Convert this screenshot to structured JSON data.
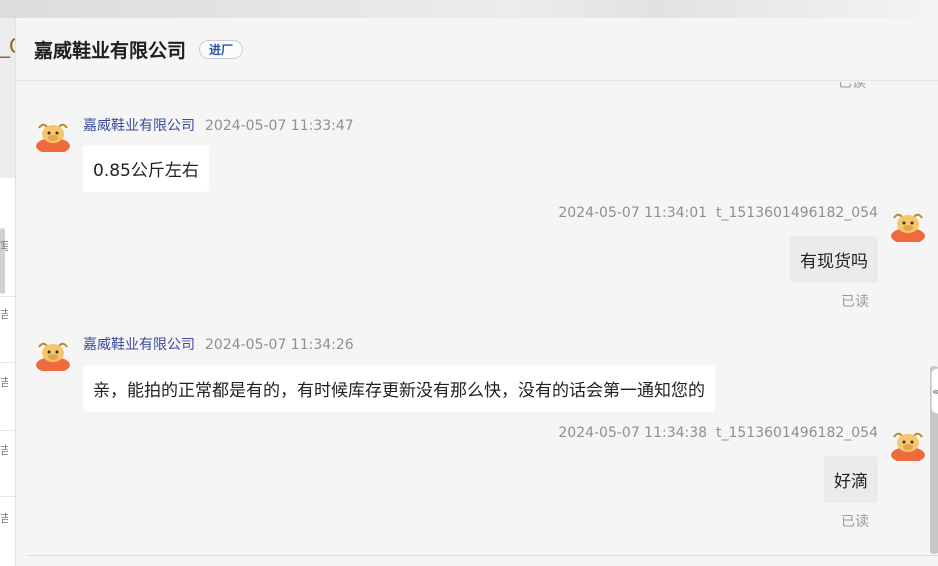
{
  "background": {
    "left_fragment": "_C",
    "left_items": [
      "写",
      "吉",
      "吉",
      "吉",
      "吉"
    ]
  },
  "header": {
    "title": "嘉威鞋业有限公司",
    "badge": "进厂"
  },
  "messages": [
    {
      "direction": "out",
      "read_status": "已读"
    },
    {
      "direction": "in",
      "sender": "嘉威鞋业有限公司",
      "time": "2024-05-07 11:33:47",
      "text": "0.85公斤左右"
    },
    {
      "direction": "out",
      "time": "2024-05-07 11:34:01",
      "sender": "t_1513601496182_054",
      "text": "有现货吗",
      "read_status": "已读"
    },
    {
      "direction": "in",
      "sender": "嘉威鞋业有限公司",
      "time": "2024-05-07 11:34:26",
      "text": "亲，能拍的正常都是有的，有时候库存更新没有那么快，没有的话会第一通知您的"
    },
    {
      "direction": "out",
      "time": "2024-05-07 11:34:38",
      "sender": "t_1513601496182_054",
      "text": "好滴",
      "read_status": "已读"
    }
  ],
  "sidebar_toggle_icon": "double-chevron-left-icon",
  "colors": {
    "sender": "#3b4a9e",
    "badge_text": "#2a56a6",
    "avatar_body": "#ef6a3c",
    "avatar_face": "#f6c76a"
  }
}
